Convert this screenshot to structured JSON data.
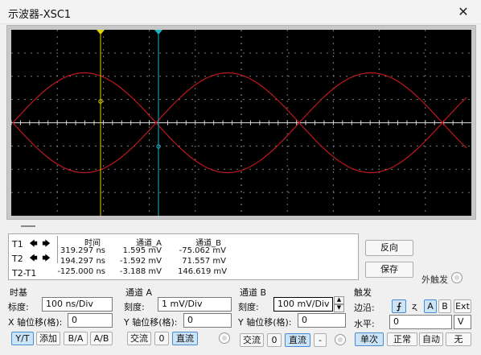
{
  "window": {
    "title": "示波器-XSC1",
    "close_glyph": "✕"
  },
  "readout": {
    "rows": [
      "T1",
      "T2",
      "T2-T1"
    ],
    "arrow_left": "🡄",
    "arrow_right": "🡆",
    "headers": {
      "time": "时间",
      "cha": "通道_A",
      "chb": "通道_B"
    },
    "values": [
      {
        "time": "319.297 ns",
        "cha": "1.595 mV",
        "chb": "-75.062 mV"
      },
      {
        "time": "194.297 ns",
        "cha": "-1.592 mV",
        "chb": "71.557 mV"
      },
      {
        "time": "-125.000 ns",
        "cha": "-3.188 mV",
        "chb": "146.619 mV"
      }
    ]
  },
  "side_buttons": {
    "reverse": "反向",
    "save": "保存",
    "ext_trigger": "外触发"
  },
  "timebase": {
    "title": "时基",
    "scale_label": "标度:",
    "scale_value": "100 ns/Div",
    "xpos_label": "X 轴位移(格):",
    "xpos_value": "0",
    "modes": [
      "Y/T",
      "添加",
      "B/A",
      "A/B"
    ],
    "active_mode": "Y/T"
  },
  "channel_a": {
    "title": "通道 A",
    "scale_label": "刻度:",
    "scale_value": "1 mV/Div",
    "ypos_label": "Y 轴位移(格):",
    "ypos_value": "0",
    "coupling": [
      "交流",
      "0",
      "直流"
    ],
    "active_coupling": "直流"
  },
  "channel_b": {
    "title": "通道 B",
    "scale_label": "刻度:",
    "scale_value": "100 mV/Div",
    "ypos_label": "Y 轴位移(格):",
    "ypos_value": "0",
    "coupling": [
      "交流",
      "0",
      "直流",
      "-"
    ],
    "active_coupling": "直流"
  },
  "trigger": {
    "title": "触发",
    "edge_label": "边沿:",
    "edge_rising": "⨍",
    "edge_falling": "ʐ",
    "sources": [
      "A",
      "B",
      "Ext"
    ],
    "active_source": "A",
    "level_label": "水平:",
    "level_value": "0",
    "level_unit": "V",
    "modes": [
      "单次",
      "正常",
      "自动",
      "无"
    ],
    "active_mode": "单次"
  },
  "colors": {
    "screen_bg": "#000000",
    "grid": "#9a9a9a",
    "trace": "#c0181e",
    "cursor_t1": "#e6d200",
    "cursor_t2": "#1fb3c4",
    "frame": "#c7c7c7",
    "active_button": "#cce4f7"
  }
}
